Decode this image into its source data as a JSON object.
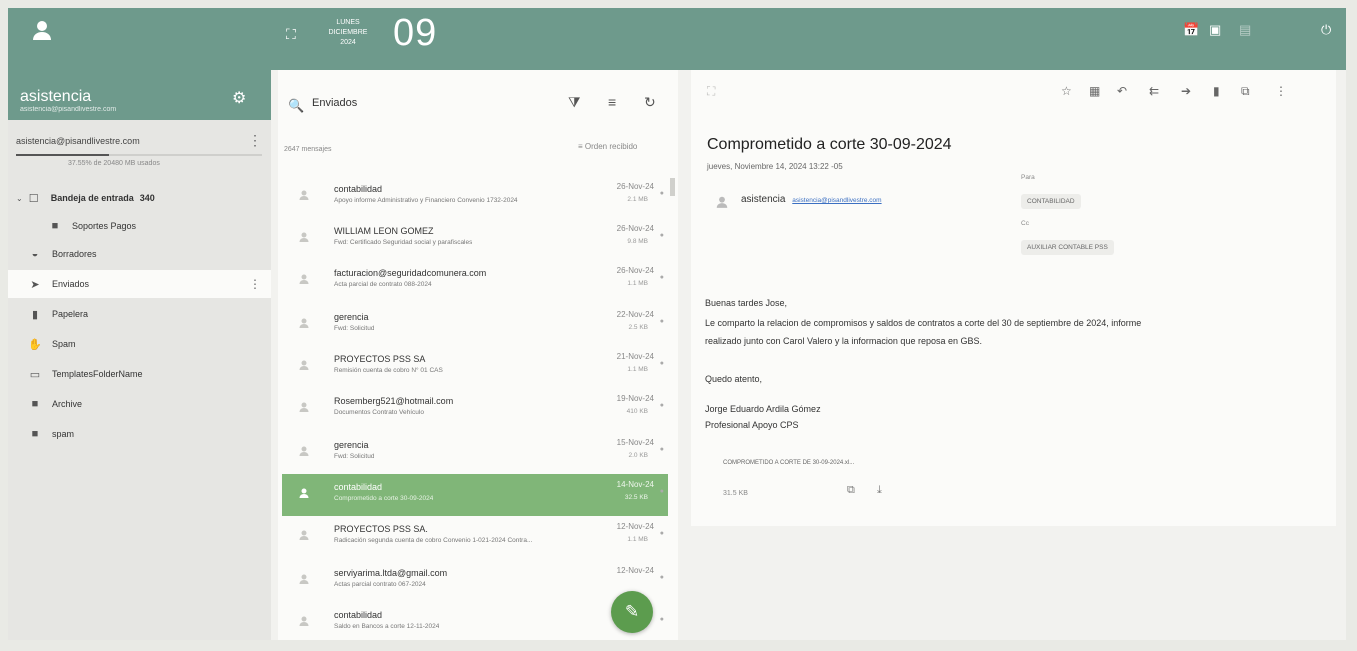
{
  "sidebar": {
    "account_name": "asistencia",
    "account_email": "asistencia@pisandlivestre.com",
    "account_row": "asistencia@pisandlivestre.com",
    "quota_text": "37.55% de 20480 MB usados",
    "quota_fraction": 0.38,
    "folders": [
      {
        "label": "Bandeja de entrada",
        "count": "340",
        "icon": "inbox-icon"
      },
      {
        "label": "Soportes Pagos",
        "icon": "folder-icon"
      },
      {
        "label": "Borradores",
        "icon": "drafts-icon"
      },
      {
        "label": "Enviados",
        "icon": "send-icon"
      },
      {
        "label": "Papelera",
        "icon": "trash-icon"
      },
      {
        "label": "Spam",
        "icon": "spam-icon"
      },
      {
        "label": "TemplatesFolderName",
        "icon": "template-icon"
      },
      {
        "label": "Archive",
        "icon": "folder-icon"
      },
      {
        "label": "spam",
        "icon": "folder-icon"
      }
    ]
  },
  "topbar": {
    "weekday": "LUNES",
    "month": "DICIEMBRE",
    "year": "2024",
    "day": "09"
  },
  "list": {
    "search_value": "Enviados",
    "message_count": "2647 mensajes",
    "sort_label": "Orden recibido",
    "messages": [
      {
        "from": "contabilidad",
        "subject": "Apoyo informe Administrativo y Financiero Convenio 1732-2024",
        "date": "26-Nov-24",
        "size": "2.1 MB"
      },
      {
        "from": "WILLIAM LEON GOMEZ",
        "subject": "Fwd: Certificado Seguridad social y parafiscales",
        "date": "26-Nov-24",
        "size": "9.8 MB"
      },
      {
        "from": "facturacion@seguridadcomunera.com",
        "subject": "Acta parcial de contrato 088-2024",
        "date": "26-Nov-24",
        "size": "1.1 MB"
      },
      {
        "from": "gerencia",
        "subject": "Fwd: Solicitud",
        "date": "22-Nov-24",
        "size": "2.5 KB"
      },
      {
        "from": "PROYECTOS PSS SA",
        "subject": "Remisión cuenta de cobro N° 01 CAS",
        "date": "21-Nov-24",
        "size": "1.1 MB"
      },
      {
        "from": "Rosemberg521@hotmail.com",
        "subject": "Documentos Contrato Vehículo",
        "date": "19-Nov-24",
        "size": "410 KB"
      },
      {
        "from": "gerencia",
        "subject": "Fwd: Solicitud",
        "date": "15-Nov-24",
        "size": "2.0 KB"
      },
      {
        "from": "contabilidad",
        "subject": "Comprometido a corte 30-09-2024",
        "date": "14-Nov-24",
        "size": "32.5 KB"
      },
      {
        "from": "PROYECTOS PSS SA.",
        "subject": "Radicación segunda cuenta de cobro Convenio 1-021-2024 Contra...",
        "date": "12-Nov-24",
        "size": "1.1 MB"
      },
      {
        "from": "serviyarima.ltda@gmail.com",
        "subject": "Actas parcial contrato 067-2024",
        "date": "12-Nov-24",
        "size": ""
      },
      {
        "from": "contabilidad",
        "subject": "Saldo en Bancos a corte 12-11-2024",
        "date": "",
        "size": ""
      }
    ]
  },
  "reader": {
    "subject": "Comprometido a corte 30-09-2024",
    "datetime": "jueves, Noviembre 14, 2024 13:22 -05",
    "sender_name": "asistencia",
    "sender_email": "asistencia@pisandlivestre.com",
    "to_label": "Para",
    "to_chip": "CONTABILIDAD",
    "cc_label": "Cc",
    "cc_chip": "AUXILIAR CONTABLE PSS",
    "body": [
      "Buenas tardes Jose,",
      "Le comparto la relacion de compromisos y saldos de contratos a corte del 30 de septiembre de 2024, informe",
      "realizado junto con Carol Valero y la informacion que reposa en GBS.",
      "Quedo atento,",
      "Jorge Eduardo Ardila Gómez",
      "Profesional Apoyo CPS"
    ],
    "attachment_name": "COMPROMETIDO A CORTE DE 30-09-2024.xl...",
    "attachment_size": "31.5 KB"
  },
  "colors": {
    "header": "#6e9a8c",
    "selected": "#80b678",
    "fab": "#5c9c4e"
  }
}
